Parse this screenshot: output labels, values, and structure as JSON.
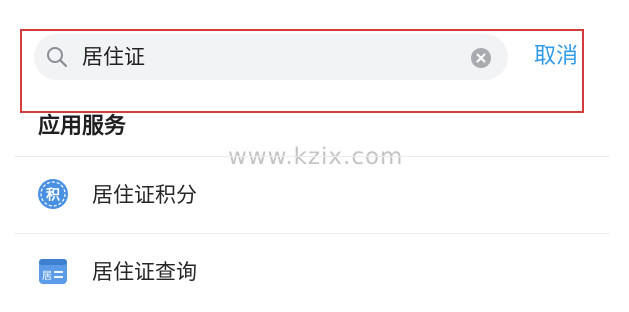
{
  "search": {
    "value": "居住证",
    "cancel_label": "取消"
  },
  "section": {
    "title": "应用服务"
  },
  "watermark": "www.kzix.com",
  "services": [
    {
      "label": "居住证积分",
      "icon": "points-badge-icon",
      "icon_text": "积"
    },
    {
      "label": "居住证查询",
      "icon": "residence-card-icon",
      "icon_text": "居"
    }
  ],
  "colors": {
    "accent": "#2f9bea",
    "highlight": "#d23c3c",
    "icon_blue": "#4a90e2"
  }
}
